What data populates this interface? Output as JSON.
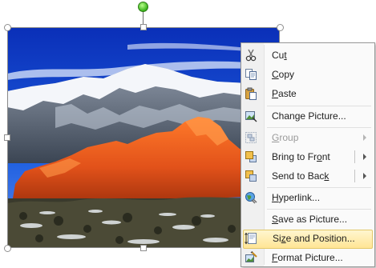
{
  "menu": {
    "items": [
      {
        "label_pre": "Cu",
        "label_ul": "t",
        "label_post": "",
        "icon": "scissors-icon",
        "enabled": true,
        "submenu": false
      },
      {
        "label_pre": "",
        "label_ul": "C",
        "label_post": "opy",
        "icon": "copy-icon",
        "enabled": true,
        "submenu": false
      },
      {
        "label_pre": "",
        "label_ul": "P",
        "label_post": "aste",
        "icon": "paste-icon",
        "enabled": true,
        "submenu": false
      },
      {
        "label_pre": "Change Picture...",
        "label_ul": "",
        "label_post": "",
        "icon": "change-picture-icon",
        "enabled": true,
        "submenu": false
      },
      {
        "label_pre": "",
        "label_ul": "G",
        "label_post": "roup",
        "icon": "group-icon",
        "enabled": false,
        "submenu": true
      },
      {
        "label_pre": "Bring to Fr",
        "label_ul": "o",
        "label_post": "nt",
        "icon": "bring-to-front-icon",
        "enabled": true,
        "submenu": true
      },
      {
        "label_pre": "Send to Bac",
        "label_ul": "k",
        "label_post": "",
        "icon": "send-to-back-icon",
        "enabled": true,
        "submenu": true
      },
      {
        "label_pre": "",
        "label_ul": "H",
        "label_post": "yperlink...",
        "icon": "hyperlink-globe-icon",
        "enabled": true,
        "submenu": false
      },
      {
        "label_pre": "",
        "label_ul": "S",
        "label_post": "ave as Picture...",
        "icon": "",
        "enabled": true,
        "submenu": false
      },
      {
        "label_pre": "Si",
        "label_ul": "z",
        "label_post": "e and Position...",
        "icon": "size-position-icon",
        "enabled": true,
        "submenu": false,
        "highlighted": true
      },
      {
        "label_pre": "",
        "label_ul": "F",
        "label_post": "ormat Picture...",
        "icon": "format-picture-icon",
        "enabled": true,
        "submenu": false
      }
    ]
  },
  "colors": {
    "highlight_top": "#fff6cf",
    "highlight_bottom": "#ffe595",
    "rotate_handle": "#39b21b"
  }
}
